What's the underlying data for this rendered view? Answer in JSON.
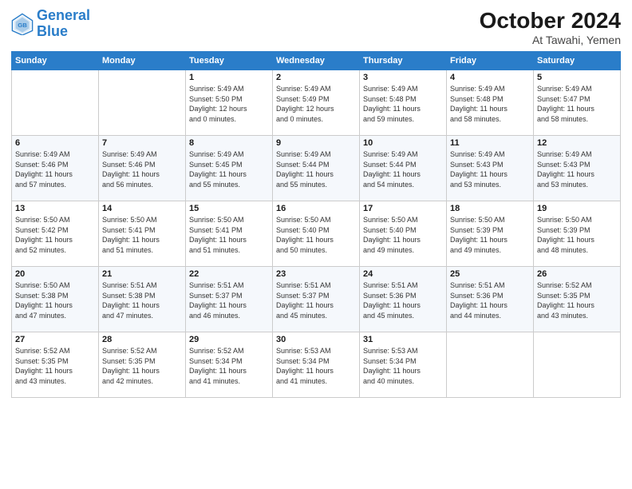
{
  "logo": {
    "line1": "General",
    "line2": "Blue"
  },
  "title": "October 2024",
  "location": "At Tawahi, Yemen",
  "weekdays": [
    "Sunday",
    "Monday",
    "Tuesday",
    "Wednesday",
    "Thursday",
    "Friday",
    "Saturday"
  ],
  "weeks": [
    [
      {
        "day": "",
        "info": ""
      },
      {
        "day": "",
        "info": ""
      },
      {
        "day": "1",
        "info": "Sunrise: 5:49 AM\nSunset: 5:50 PM\nDaylight: 12 hours\nand 0 minutes."
      },
      {
        "day": "2",
        "info": "Sunrise: 5:49 AM\nSunset: 5:49 PM\nDaylight: 12 hours\nand 0 minutes."
      },
      {
        "day": "3",
        "info": "Sunrise: 5:49 AM\nSunset: 5:48 PM\nDaylight: 11 hours\nand 59 minutes."
      },
      {
        "day": "4",
        "info": "Sunrise: 5:49 AM\nSunset: 5:48 PM\nDaylight: 11 hours\nand 58 minutes."
      },
      {
        "day": "5",
        "info": "Sunrise: 5:49 AM\nSunset: 5:47 PM\nDaylight: 11 hours\nand 58 minutes."
      }
    ],
    [
      {
        "day": "6",
        "info": "Sunrise: 5:49 AM\nSunset: 5:46 PM\nDaylight: 11 hours\nand 57 minutes."
      },
      {
        "day": "7",
        "info": "Sunrise: 5:49 AM\nSunset: 5:46 PM\nDaylight: 11 hours\nand 56 minutes."
      },
      {
        "day": "8",
        "info": "Sunrise: 5:49 AM\nSunset: 5:45 PM\nDaylight: 11 hours\nand 55 minutes."
      },
      {
        "day": "9",
        "info": "Sunrise: 5:49 AM\nSunset: 5:44 PM\nDaylight: 11 hours\nand 55 minutes."
      },
      {
        "day": "10",
        "info": "Sunrise: 5:49 AM\nSunset: 5:44 PM\nDaylight: 11 hours\nand 54 minutes."
      },
      {
        "day": "11",
        "info": "Sunrise: 5:49 AM\nSunset: 5:43 PM\nDaylight: 11 hours\nand 53 minutes."
      },
      {
        "day": "12",
        "info": "Sunrise: 5:49 AM\nSunset: 5:43 PM\nDaylight: 11 hours\nand 53 minutes."
      }
    ],
    [
      {
        "day": "13",
        "info": "Sunrise: 5:50 AM\nSunset: 5:42 PM\nDaylight: 11 hours\nand 52 minutes."
      },
      {
        "day": "14",
        "info": "Sunrise: 5:50 AM\nSunset: 5:41 PM\nDaylight: 11 hours\nand 51 minutes."
      },
      {
        "day": "15",
        "info": "Sunrise: 5:50 AM\nSunset: 5:41 PM\nDaylight: 11 hours\nand 51 minutes."
      },
      {
        "day": "16",
        "info": "Sunrise: 5:50 AM\nSunset: 5:40 PM\nDaylight: 11 hours\nand 50 minutes."
      },
      {
        "day": "17",
        "info": "Sunrise: 5:50 AM\nSunset: 5:40 PM\nDaylight: 11 hours\nand 49 minutes."
      },
      {
        "day": "18",
        "info": "Sunrise: 5:50 AM\nSunset: 5:39 PM\nDaylight: 11 hours\nand 49 minutes."
      },
      {
        "day": "19",
        "info": "Sunrise: 5:50 AM\nSunset: 5:39 PM\nDaylight: 11 hours\nand 48 minutes."
      }
    ],
    [
      {
        "day": "20",
        "info": "Sunrise: 5:50 AM\nSunset: 5:38 PM\nDaylight: 11 hours\nand 47 minutes."
      },
      {
        "day": "21",
        "info": "Sunrise: 5:51 AM\nSunset: 5:38 PM\nDaylight: 11 hours\nand 47 minutes."
      },
      {
        "day": "22",
        "info": "Sunrise: 5:51 AM\nSunset: 5:37 PM\nDaylight: 11 hours\nand 46 minutes."
      },
      {
        "day": "23",
        "info": "Sunrise: 5:51 AM\nSunset: 5:37 PM\nDaylight: 11 hours\nand 45 minutes."
      },
      {
        "day": "24",
        "info": "Sunrise: 5:51 AM\nSunset: 5:36 PM\nDaylight: 11 hours\nand 45 minutes."
      },
      {
        "day": "25",
        "info": "Sunrise: 5:51 AM\nSunset: 5:36 PM\nDaylight: 11 hours\nand 44 minutes."
      },
      {
        "day": "26",
        "info": "Sunrise: 5:52 AM\nSunset: 5:35 PM\nDaylight: 11 hours\nand 43 minutes."
      }
    ],
    [
      {
        "day": "27",
        "info": "Sunrise: 5:52 AM\nSunset: 5:35 PM\nDaylight: 11 hours\nand 43 minutes."
      },
      {
        "day": "28",
        "info": "Sunrise: 5:52 AM\nSunset: 5:35 PM\nDaylight: 11 hours\nand 42 minutes."
      },
      {
        "day": "29",
        "info": "Sunrise: 5:52 AM\nSunset: 5:34 PM\nDaylight: 11 hours\nand 41 minutes."
      },
      {
        "day": "30",
        "info": "Sunrise: 5:53 AM\nSunset: 5:34 PM\nDaylight: 11 hours\nand 41 minutes."
      },
      {
        "day": "31",
        "info": "Sunrise: 5:53 AM\nSunset: 5:34 PM\nDaylight: 11 hours\nand 40 minutes."
      },
      {
        "day": "",
        "info": ""
      },
      {
        "day": "",
        "info": ""
      }
    ]
  ]
}
